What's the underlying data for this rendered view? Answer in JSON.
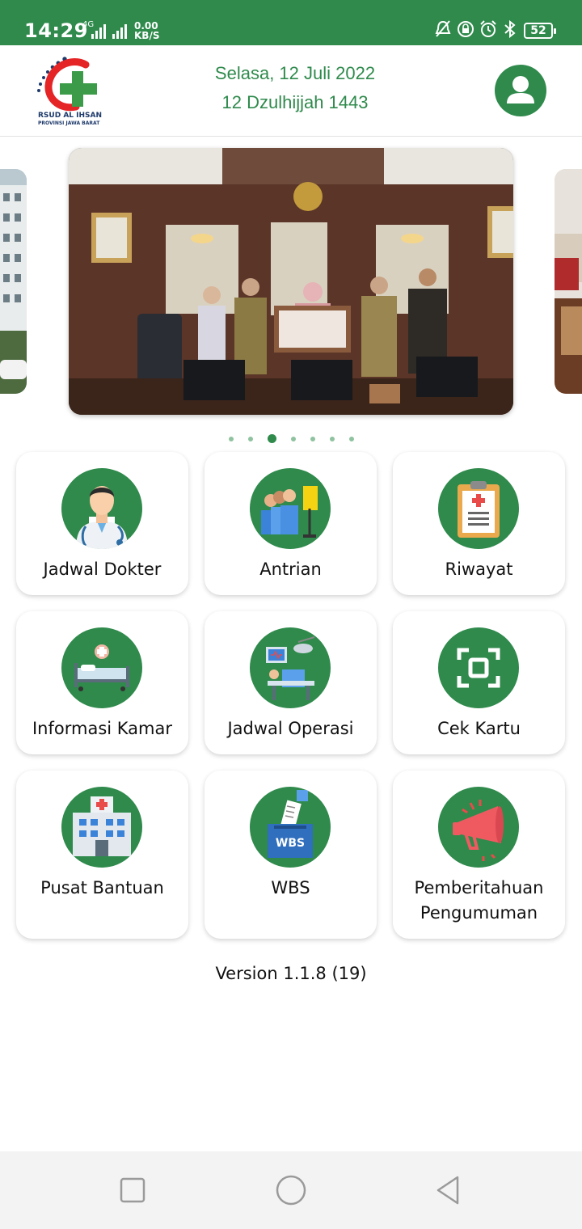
{
  "status_bar": {
    "time": "14:29",
    "network_label": "4G",
    "speed_value": "0.00",
    "speed_unit": "KB/S",
    "battery": "52",
    "icons": [
      "signal-icon",
      "mute-icon",
      "lock-icon",
      "alarm-icon",
      "bluetooth-icon"
    ]
  },
  "header": {
    "logo_title": "RSUD AL IHSAN",
    "logo_subtitle": "PROVINSI JAWA BARAT",
    "date_gregorian": "Selasa, 12 Juli 2022",
    "date_hijri": "12 Dzulhijjah 1443",
    "profile_icon": "user-icon"
  },
  "carousel": {
    "slide_count": 7,
    "active_index": 2
  },
  "menu": [
    {
      "label": "Jadwal Dokter",
      "icon": "doctor-icon"
    },
    {
      "label": "Antrian",
      "icon": "queue-icon"
    },
    {
      "label": "Riwayat",
      "icon": "clipboard-icon"
    },
    {
      "label": "Informasi Kamar",
      "icon": "hospital-bed-icon"
    },
    {
      "label": "Jadwal Operasi",
      "icon": "operating-room-icon"
    },
    {
      "label": "Cek Kartu",
      "icon": "scan-icon"
    },
    {
      "label": "Pusat Bantuan",
      "icon": "hospital-building-icon"
    },
    {
      "label": "WBS",
      "icon": "ballot-box-icon",
      "badge": "WBS"
    },
    {
      "label": "Pemberitahuan Pengumuman",
      "icon": "megaphone-icon"
    }
  ],
  "version": "Version 1.1.8 (19)",
  "colors": {
    "primary": "#2f8a4c",
    "dot_inactive": "#8fc29f"
  },
  "nav": {
    "icons": [
      "recents-icon",
      "home-icon",
      "back-icon"
    ]
  }
}
